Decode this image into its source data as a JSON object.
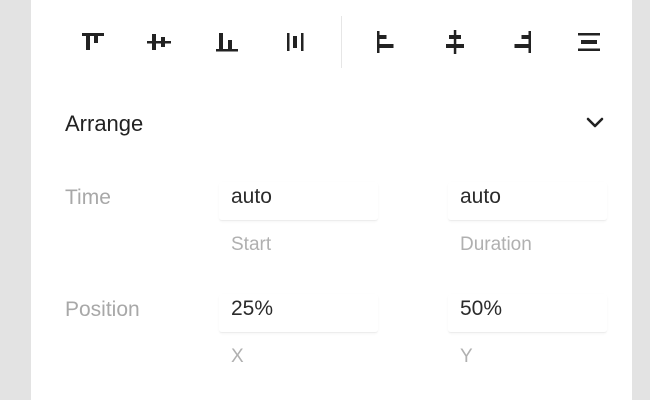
{
  "toolbar": {
    "icons": [
      "align-top-icon",
      "align-vertical-center-icon",
      "align-bottom-icon",
      "distribute-vertical-icon",
      "align-left-icon",
      "align-horizontal-center-icon",
      "align-right-icon",
      "distribute-horizontal-icon"
    ]
  },
  "arrange": {
    "title": "Arrange",
    "toggle_icon": "chevron-down-icon",
    "time": {
      "label": "Time",
      "start": {
        "value": "auto",
        "caption": "Start"
      },
      "duration": {
        "value": "auto",
        "caption": "Duration"
      }
    },
    "position": {
      "label": "Position",
      "x": {
        "value": "25%",
        "caption": "X"
      },
      "y": {
        "value": "50%",
        "caption": "Y"
      }
    }
  },
  "colors": {
    "panel": "#ffffff",
    "background": "#e3e3e3",
    "icon": "#222222",
    "label": "#a8a8a8",
    "caption": "#b0b0b0",
    "text": "#2b2b2b"
  }
}
